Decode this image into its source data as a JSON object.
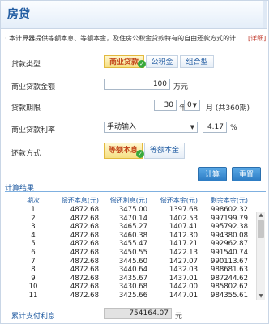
{
  "header": {
    "title": "房贷"
  },
  "description": {
    "text": "· 本计算器提供等额本息、等额本金，及住房公积金贷款特有的自由还款方式的计",
    "link": "[详细]"
  },
  "loan_type": {
    "label": "贷款类型",
    "options": [
      "商业贷款",
      "公积金",
      "组合型"
    ],
    "selected": "商业贷款"
  },
  "amount": {
    "label": "商业贷款金额",
    "value": "100",
    "unit": "万元"
  },
  "term": {
    "label": "贷款期限",
    "years": "30",
    "years_unit": "年",
    "months": "0",
    "months_unit": "月 (共360期)"
  },
  "rate": {
    "label": "商业贷款利率",
    "mode": "手动输入",
    "value": "4.17",
    "unit": "%"
  },
  "repay": {
    "label": "还款方式",
    "options": [
      "等额本息",
      "等额本金"
    ],
    "selected": "等额本息"
  },
  "buttons": {
    "calc": "计算",
    "reset": "重置"
  },
  "results": {
    "title": "计算结果",
    "columns": [
      "期次",
      "偿还本息(元)",
      "偿还利息(元)",
      "偿还本金(元)",
      "剩余本金(元)"
    ],
    "rows": [
      [
        "1",
        "4872.68",
        "3475.00",
        "1397.68",
        "998602.32"
      ],
      [
        "2",
        "4872.68",
        "3470.14",
        "1402.53",
        "997199.79"
      ],
      [
        "3",
        "4872.68",
        "3465.27",
        "1407.41",
        "995792.38"
      ],
      [
        "4",
        "4872.68",
        "3460.38",
        "1412.30",
        "994380.08"
      ],
      [
        "5",
        "4872.68",
        "3455.47",
        "1417.21",
        "992962.87"
      ],
      [
        "6",
        "4872.68",
        "3450.55",
        "1422.13",
        "991540.74"
      ],
      [
        "7",
        "4872.68",
        "3445.60",
        "1427.07",
        "990113.67"
      ],
      [
        "8",
        "4872.68",
        "3440.64",
        "1432.03",
        "988681.63"
      ],
      [
        "9",
        "4872.68",
        "3435.67",
        "1437.01",
        "987244.62"
      ],
      [
        "10",
        "4872.68",
        "3430.68",
        "1442.00",
        "985802.62"
      ],
      [
        "11",
        "4872.68",
        "3425.66",
        "1447.01",
        "984355.61"
      ]
    ]
  },
  "total_interest": {
    "label": "累计支付利息",
    "value": "754164.07",
    "unit": "元"
  }
}
